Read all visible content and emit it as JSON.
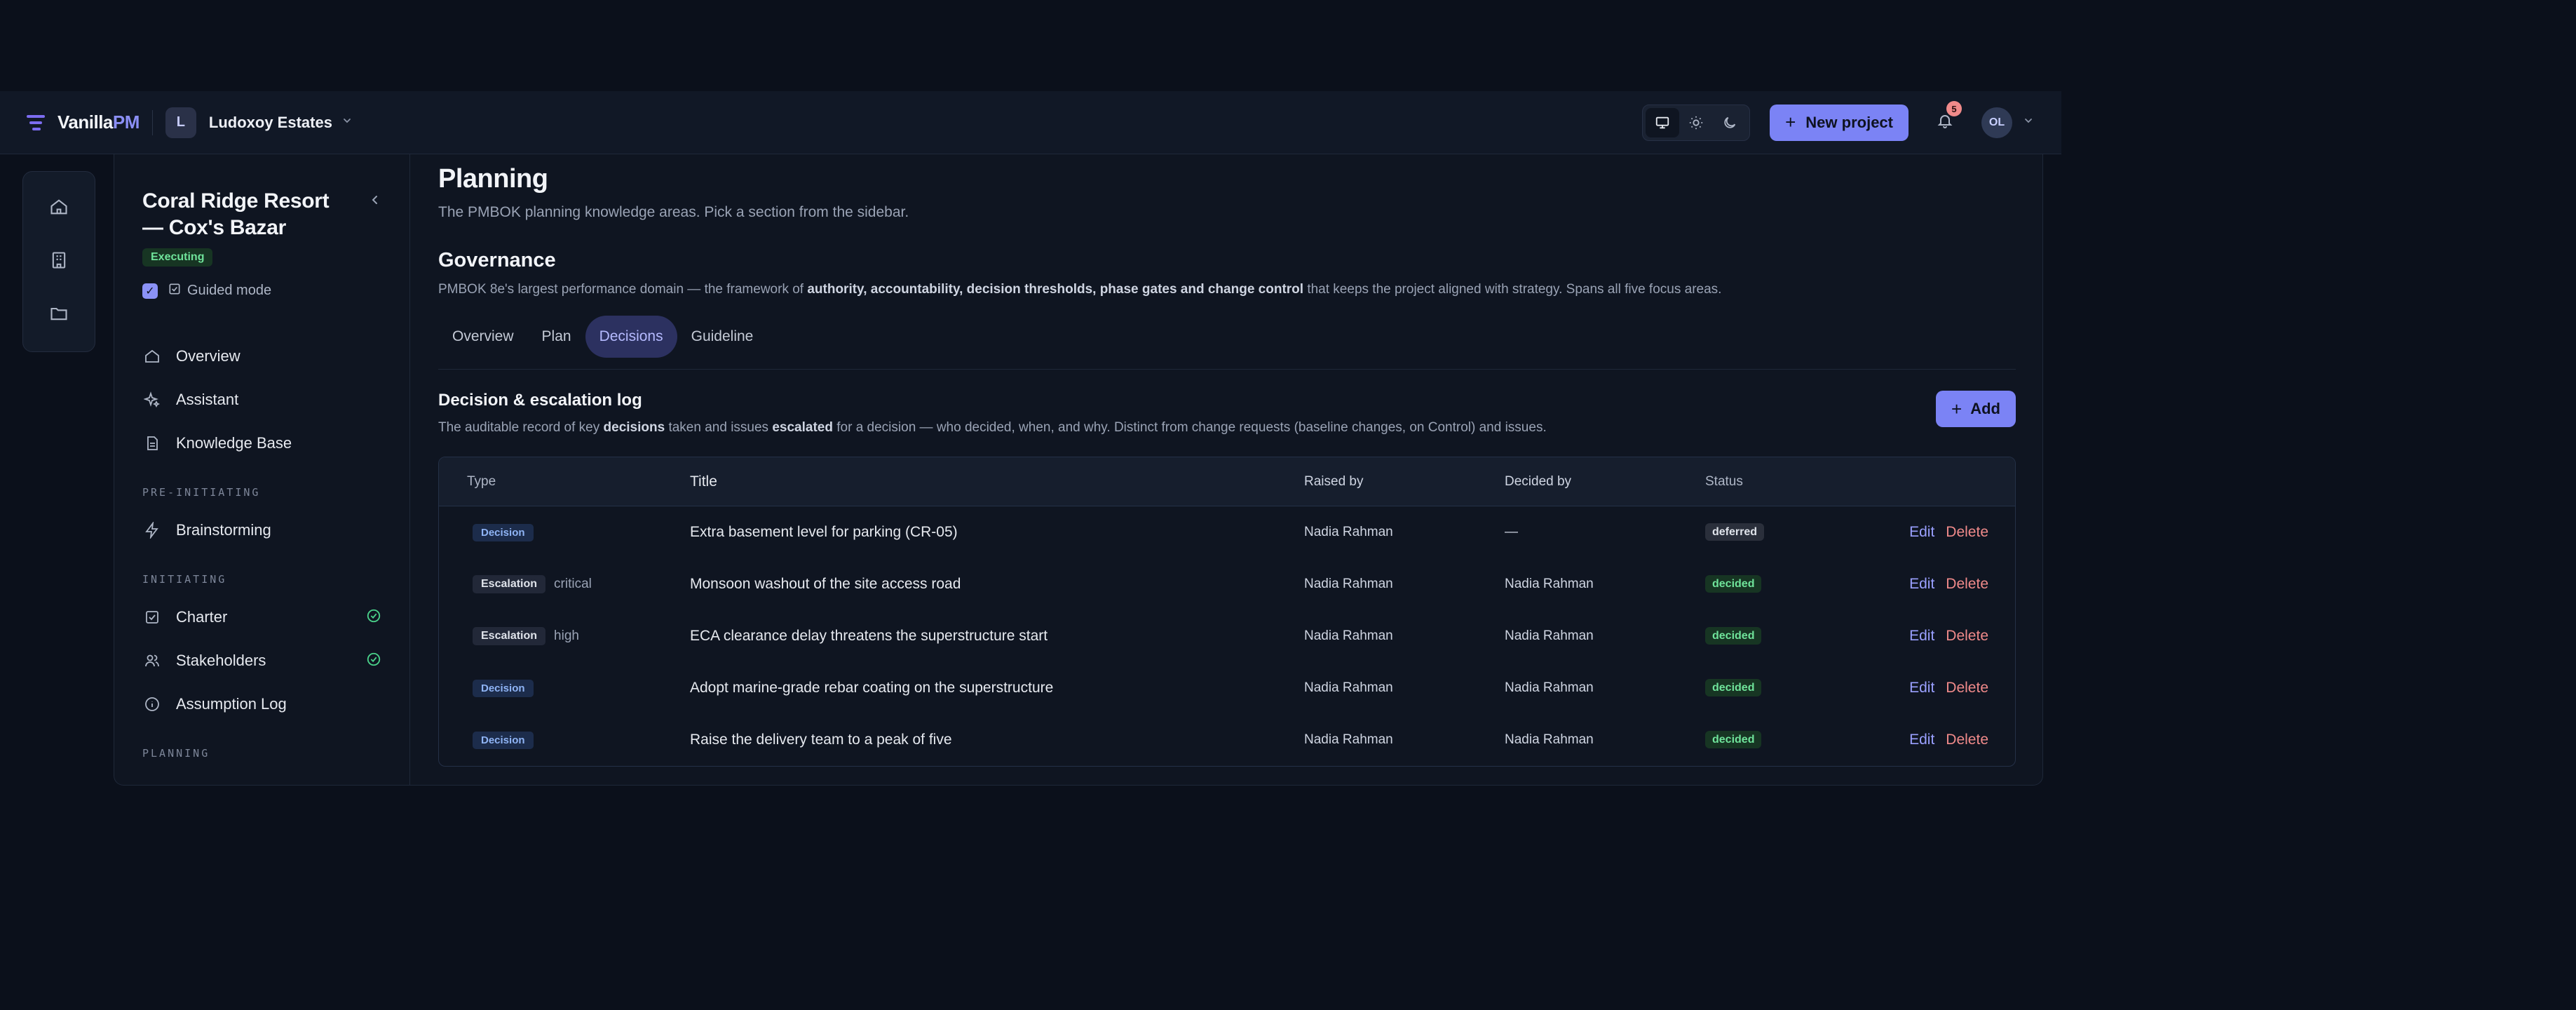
{
  "topbar": {
    "brand_main": "Vanilla",
    "brand_accent": "PM",
    "workspace_initial": "L",
    "workspace_name": "Ludoxoy Estates",
    "new_project_label": "New project",
    "notification_count": "5",
    "user_initials": "OL"
  },
  "sidebar": {
    "project_title": "Coral Ridge Resort — Cox's Bazar",
    "project_status": "Executing",
    "guided_mode_label": "Guided mode",
    "items_top": [
      {
        "label": "Overview",
        "icon": "home-icon"
      },
      {
        "label": "Assistant",
        "icon": "sparkle-icon"
      },
      {
        "label": "Knowledge Base",
        "icon": "document-icon"
      }
    ],
    "sections": {
      "pre_initiating": "PRE-INITIATING",
      "initiating": "INITIATING",
      "planning": "PLANNING"
    },
    "pre_items": [
      {
        "label": "Brainstorming",
        "icon": "lightning-icon"
      }
    ],
    "init_items": [
      {
        "label": "Charter",
        "icon": "checkbox-icon",
        "done": true
      },
      {
        "label": "Stakeholders",
        "icon": "users-icon",
        "done": true
      },
      {
        "label": "Assumption Log",
        "icon": "info-icon",
        "done": false
      }
    ]
  },
  "main": {
    "page_title": "Planning",
    "page_subtitle": "The PMBOK planning knowledge areas. Pick a section from the sidebar.",
    "section_title": "Governance",
    "section_desc_1": "PMBOK 8e's largest performance domain — the framework of ",
    "section_desc_bold": "authority, accountability, decision thresholds, phase gates and change control",
    "section_desc_2": " that keeps the project aligned with strategy. Spans all five focus areas.",
    "tabs": [
      {
        "label": "Overview",
        "active": false
      },
      {
        "label": "Plan",
        "active": false
      },
      {
        "label": "Decisions",
        "active": true
      },
      {
        "label": "Guideline",
        "active": false
      }
    ],
    "log_title": "Decision & escalation log",
    "log_desc_1": "The auditable record of key ",
    "log_desc_b1": "decisions",
    "log_desc_2": " taken and issues ",
    "log_desc_b2": "escalated",
    "log_desc_3": " for a decision — who decided, when, and why. Distinct from change requests (baseline changes, on Control) and issues.",
    "add_label": "Add",
    "table": {
      "headers": {
        "type": "Type",
        "title": "Title",
        "raised_by": "Raised by",
        "decided_by": "Decided by",
        "status": "Status"
      },
      "edit_label": "Edit",
      "delete_label": "Delete",
      "rows": [
        {
          "type": "Decision",
          "severity": "",
          "title": "Extra basement level for parking (CR-05)",
          "raised_by": "Nadia Rahman",
          "decided_by": "—",
          "status": "deferred"
        },
        {
          "type": "Escalation",
          "severity": "critical",
          "title": "Monsoon washout of the site access road",
          "raised_by": "Nadia Rahman",
          "decided_by": "Nadia Rahman",
          "status": "decided"
        },
        {
          "type": "Escalation",
          "severity": "high",
          "title": "ECA clearance delay threatens the superstructure start",
          "raised_by": "Nadia Rahman",
          "decided_by": "Nadia Rahman",
          "status": "decided"
        },
        {
          "type": "Decision",
          "severity": "",
          "title": "Adopt marine-grade rebar coating on the superstructure",
          "raised_by": "Nadia Rahman",
          "decided_by": "Nadia Rahman",
          "status": "decided"
        },
        {
          "type": "Decision",
          "severity": "",
          "title": "Raise the delivery team to a peak of five",
          "raised_by": "Nadia Rahman",
          "decided_by": "Nadia Rahman",
          "status": "decided"
        }
      ]
    }
  },
  "colors": {
    "accent": "#7b83f5",
    "background": "#0b101b",
    "success": "#6fe39a",
    "danger": "#f08a8a"
  }
}
